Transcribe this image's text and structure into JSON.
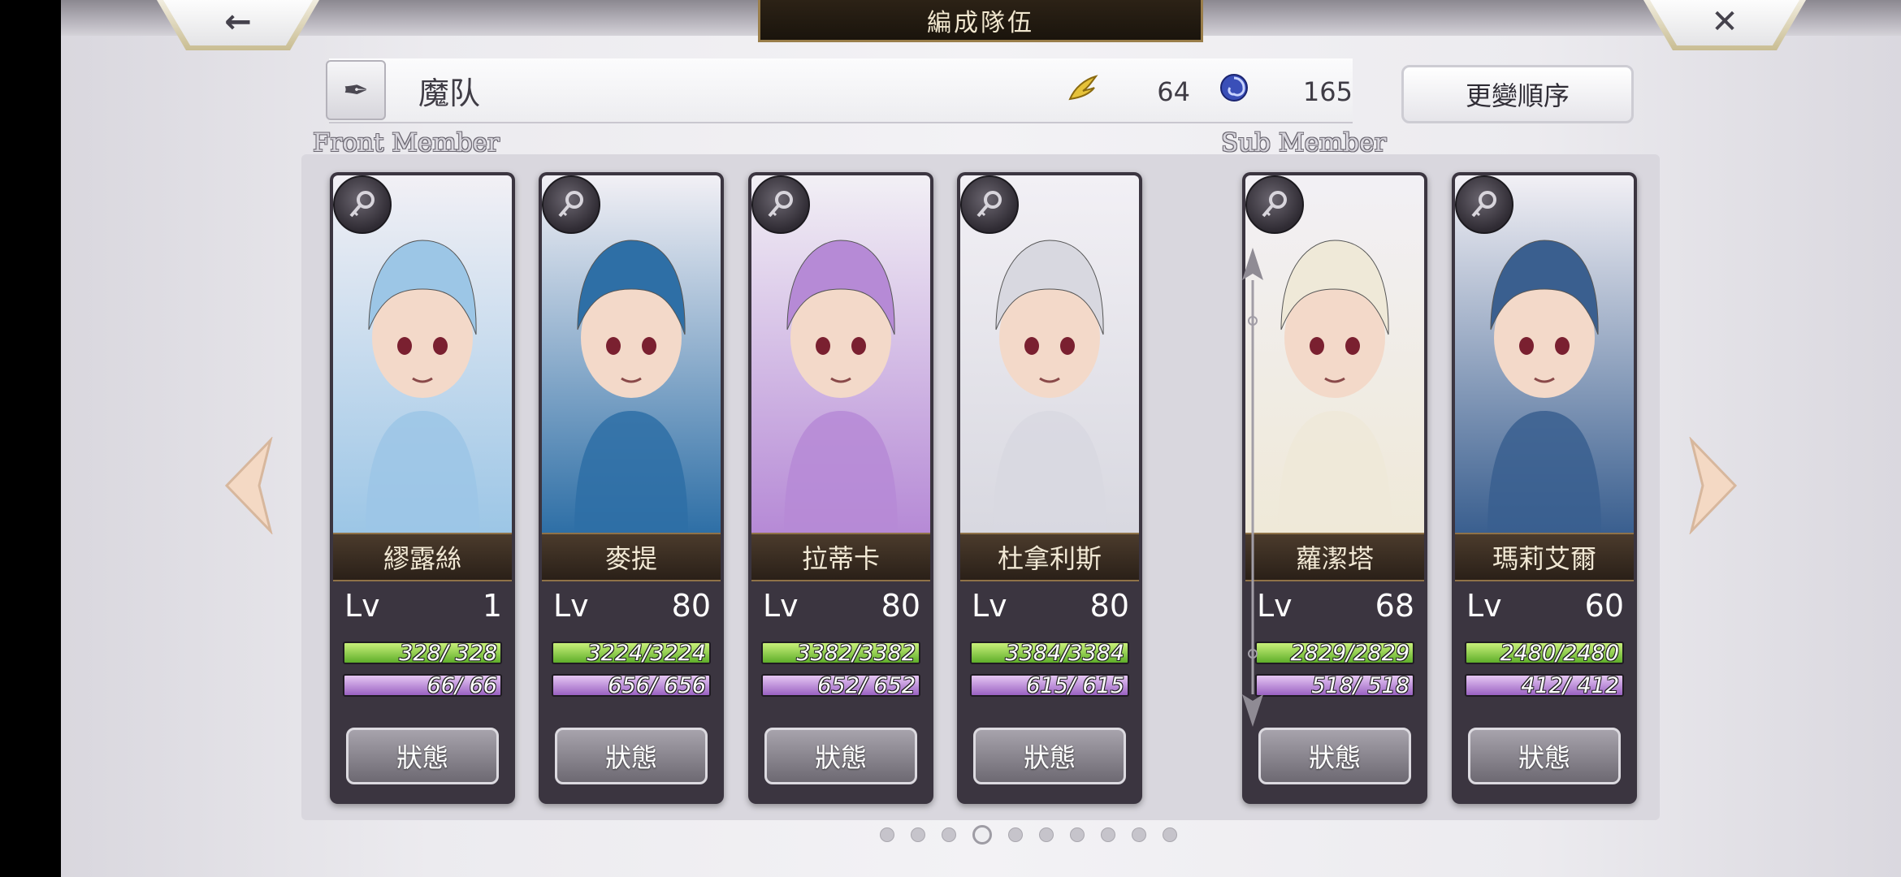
{
  "header": {
    "title": "編成隊伍",
    "back_icon": "left-arrow-icon",
    "close_icon": "close-x-icon"
  },
  "team": {
    "name": "魔队",
    "edit_icon": "feather-pen-icon",
    "resources": [
      {
        "icon": "golden-wing-icon",
        "value": "64"
      },
      {
        "icon": "blue-swirl-icon",
        "value": "165"
      }
    ],
    "reorder_label": "更變順序"
  },
  "sections": {
    "front": "Front Member",
    "sub": "Sub Member"
  },
  "members": [
    {
      "name": "繆露絲",
      "lv_label": "Lv",
      "level": "1",
      "hp": "328/ 328",
      "mp": "66/ 66",
      "hp_ratio": 1,
      "mp_ratio": 1,
      "status_label": "狀態",
      "accent": "#9cc6e6"
    },
    {
      "name": "麥提",
      "lv_label": "Lv",
      "level": "80",
      "hp": "3224/3224",
      "mp": "656/ 656",
      "hp_ratio": 1,
      "mp_ratio": 1,
      "status_label": "狀態",
      "accent": "#2e6fa6"
    },
    {
      "name": "拉蒂卡",
      "lv_label": "Lv",
      "level": "80",
      "hp": "3382/3382",
      "mp": "652/ 652",
      "hp_ratio": 1,
      "mp_ratio": 1,
      "status_label": "狀態",
      "accent": "#b68ad6"
    },
    {
      "name": "杜拿利斯",
      "lv_label": "Lv",
      "level": "80",
      "hp": "3384/3384",
      "mp": "615/ 615",
      "hp_ratio": 1,
      "mp_ratio": 1,
      "status_label": "狀態",
      "accent": "#d8d8e0"
    },
    {
      "name": "蘿潔塔",
      "lv_label": "Lv",
      "level": "68",
      "hp": "2829/2829",
      "mp": "518/ 518",
      "hp_ratio": 1,
      "mp_ratio": 1,
      "status_label": "狀態",
      "accent": "#efe9d8"
    },
    {
      "name": "瑪莉艾爾",
      "lv_label": "Lv",
      "level": "60",
      "hp": "2480/2480",
      "mp": "412/ 412",
      "hp_ratio": 1,
      "mp_ratio": 1,
      "status_label": "狀態",
      "accent": "#3a5f8f"
    }
  ],
  "pagination": {
    "total": 10,
    "active": 4
  },
  "colors": {
    "hp_bar": "#7cc23a",
    "mp_bar": "#b07fd6",
    "name_plate": "#3a2d22",
    "accent_gold": "#c8a25a"
  }
}
